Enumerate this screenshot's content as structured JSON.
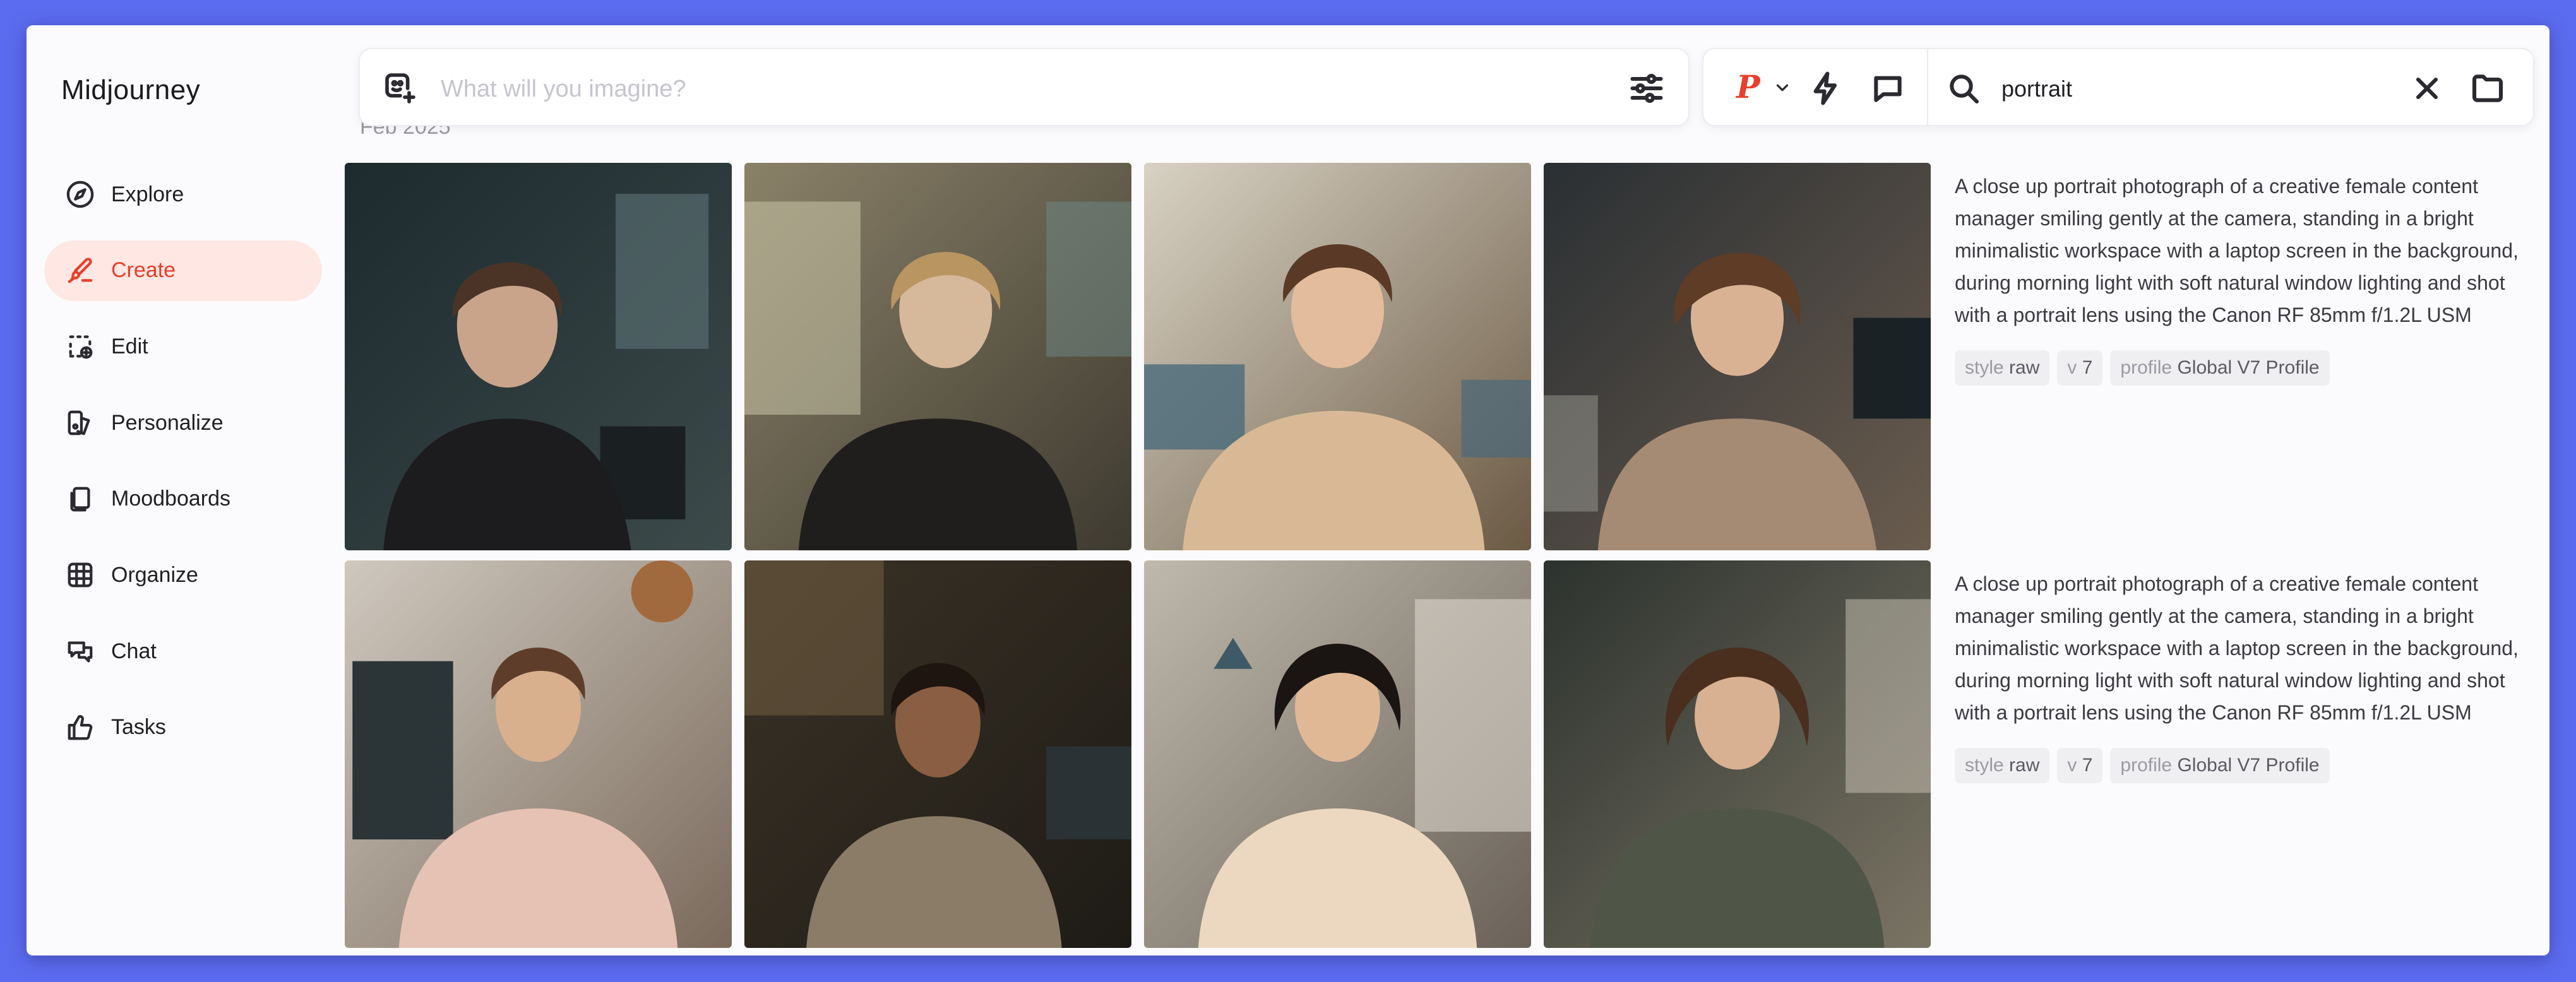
{
  "app": {
    "title": "Midjourney"
  },
  "sidebar": {
    "items": [
      {
        "label": "Explore",
        "icon": "compass-icon",
        "active": false
      },
      {
        "label": "Create",
        "icon": "brush-icon",
        "active": true
      },
      {
        "label": "Edit",
        "icon": "edit-selection-icon",
        "active": false
      },
      {
        "label": "Personalize",
        "icon": "personalize-icon",
        "active": false
      },
      {
        "label": "Moodboards",
        "icon": "moodboards-icon",
        "active": false
      },
      {
        "label": "Organize",
        "icon": "grid-icon",
        "active": false
      },
      {
        "label": "Chat",
        "icon": "chat-bubbles-icon",
        "active": false
      },
      {
        "label": "Tasks",
        "icon": "thumbs-up-icon",
        "active": false
      }
    ]
  },
  "prompt_bar": {
    "placeholder": "What will you imagine?",
    "value": ""
  },
  "toolbar": {
    "profile_letter": "P"
  },
  "search": {
    "value": "portrait"
  },
  "date_label": "Feb 2025",
  "colors": {
    "accent": "#e8402c",
    "active_bg": "#ffe7e3",
    "frame": "#5b6cf0"
  },
  "results": [
    {
      "prompt": "A close up portrait photograph of a creative female content manager smiling gently at the camera, standing in a bright minimalistic workspace with a laptop screen in the background, during morning light with soft natural window lighting and shot with a portrait lens using the Canon RF 85mm f/1.2L USM",
      "tags": [
        {
          "key": "style",
          "value": "raw"
        },
        {
          "key": "v",
          "value": "7"
        },
        {
          "key": "profile",
          "value": "Global V7 Profile"
        }
      ]
    },
    {
      "prompt": "A close up portrait photograph of a creative female content manager smiling gently at the camera, standing in a bright minimalistic workspace with a laptop screen in the background, during morning light with soft natural window lighting and shot with a portrait lens using the Canon RF 85mm f/1.2L USM",
      "tags": [
        {
          "key": "style",
          "value": "raw"
        },
        {
          "key": "v",
          "value": "7"
        },
        {
          "key": "profile",
          "value": "Global V7 Profile"
        }
      ]
    }
  ]
}
